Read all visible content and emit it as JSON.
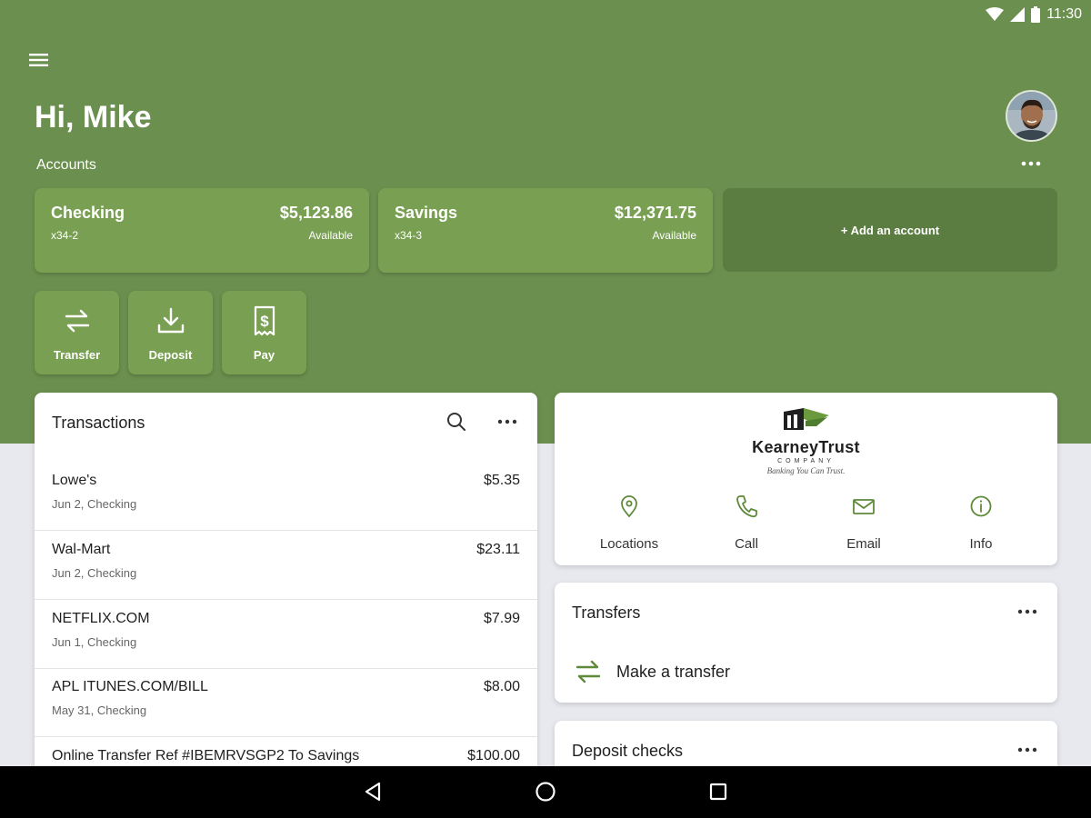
{
  "status_bar": {
    "time": "11:30"
  },
  "header": {
    "greeting": "Hi, Mike",
    "accounts_label": "Accounts"
  },
  "accounts": [
    {
      "name": "Checking",
      "number": "x34-2",
      "balance": "$5,123.86",
      "balance_label": "Available"
    },
    {
      "name": "Savings",
      "number": "x34-3",
      "balance": "$12,371.75",
      "balance_label": "Available"
    }
  ],
  "add_account_label": "+ Add an account",
  "actions": [
    {
      "label": "Transfer",
      "icon": "transfer-icon"
    },
    {
      "label": "Deposit",
      "icon": "deposit-icon"
    },
    {
      "label": "Pay",
      "icon": "pay-bill-icon"
    }
  ],
  "transactions": {
    "title": "Transactions",
    "items": [
      {
        "merchant": "Lowe's",
        "detail": "Jun 2, Checking",
        "amount": "$5.35"
      },
      {
        "merchant": "Wal-Mart",
        "detail": "Jun 2, Checking",
        "amount": "$23.11"
      },
      {
        "merchant": "NETFLIX.COM",
        "detail": "Jun 1, Checking",
        "amount": "$7.99"
      },
      {
        "merchant": "APL ITUNES.COM/BILL",
        "detail": "May 31, Checking",
        "amount": "$8.00"
      },
      {
        "merchant": "Online Transfer Ref #IBEMRVSGP2 To Savings",
        "detail": "",
        "amount": "$100.00"
      }
    ]
  },
  "brand": {
    "name": "KearneyTrust",
    "company": "COMPANY",
    "tagline": "Banking You Can Trust.",
    "contacts": [
      {
        "label": "Locations",
        "icon": "location-pin-icon"
      },
      {
        "label": "Call",
        "icon": "phone-icon"
      },
      {
        "label": "Email",
        "icon": "email-icon"
      },
      {
        "label": "Info",
        "icon": "info-icon"
      }
    ]
  },
  "transfers": {
    "title": "Transfers",
    "action_label": "Make a transfer"
  },
  "deposit_checks": {
    "title": "Deposit checks"
  },
  "colors": {
    "header_green": "#6b8f4e",
    "card_green": "#79a052",
    "add_account_green": "#5c7d41",
    "accent_green": "#5e8a3a",
    "background": "#e7e9ee"
  }
}
